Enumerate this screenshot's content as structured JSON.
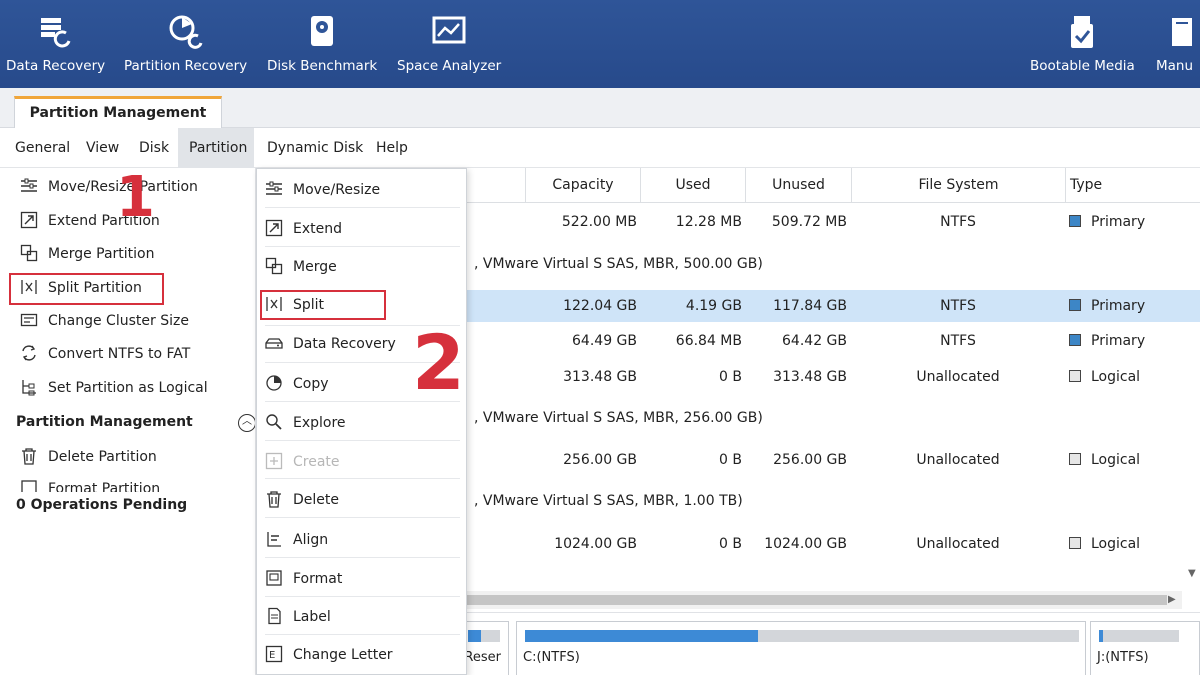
{
  "toolbar": {
    "items": [
      {
        "label": "Data Recovery",
        "icon": "data-recovery-icon"
      },
      {
        "label": "Partition Recovery",
        "icon": "partition-recovery-icon"
      },
      {
        "label": "Disk Benchmark",
        "icon": "disk-benchmark-icon"
      },
      {
        "label": "Space Analyzer",
        "icon": "space-analyzer-icon"
      },
      {
        "label": "Bootable Media",
        "icon": "bootable-media-icon"
      },
      {
        "label": "Manu",
        "icon": "manual-icon"
      }
    ]
  },
  "tab": {
    "label": "Partition Management"
  },
  "menubar": [
    "General",
    "View",
    "Disk",
    "Partition",
    "Dynamic Disk",
    "Help"
  ],
  "left_panel": {
    "items": [
      {
        "label": "Move/Resize Partition",
        "icon": "move-resize-icon"
      },
      {
        "label": "Extend Partition",
        "icon": "extend-icon"
      },
      {
        "label": "Merge Partition",
        "icon": "merge-icon"
      },
      {
        "label": "Split Partition",
        "icon": "split-icon"
      },
      {
        "label": "Change Cluster Size",
        "icon": "cluster-size-icon"
      },
      {
        "label": "Convert NTFS to FAT",
        "icon": "convert-icon"
      },
      {
        "label": "Set Partition as Logical",
        "icon": "set-logical-icon"
      }
    ],
    "section_title": "Partition Management",
    "section_items": [
      {
        "label": "Delete Partition",
        "icon": "delete-icon"
      },
      {
        "label": "Format Partition",
        "icon": "format-icon"
      }
    ],
    "pending": "0 Operations Pending"
  },
  "dropdown": {
    "items": [
      {
        "label": "Move/Resize",
        "icon": "move-resize-icon",
        "enabled": true
      },
      {
        "label": "Extend",
        "icon": "extend-icon",
        "enabled": true
      },
      {
        "label": "Merge",
        "icon": "merge-icon",
        "enabled": true
      },
      {
        "label": "Split",
        "icon": "split-icon",
        "enabled": true
      },
      {
        "label": "Data Recovery",
        "icon": "data-recovery-icon",
        "enabled": true
      },
      {
        "label": "Copy",
        "icon": "copy-icon",
        "enabled": true
      },
      {
        "label": "Explore",
        "icon": "explore-icon",
        "enabled": true
      },
      {
        "label": "Create",
        "icon": "create-icon",
        "enabled": false
      },
      {
        "label": "Delete",
        "icon": "delete-icon",
        "enabled": true
      },
      {
        "label": "Align",
        "icon": "align-icon",
        "enabled": true
      },
      {
        "label": "Format",
        "icon": "format-icon",
        "enabled": true
      },
      {
        "label": "Label",
        "icon": "label-icon",
        "enabled": true
      },
      {
        "label": "Change Letter",
        "icon": "change-letter-icon",
        "enabled": true
      }
    ]
  },
  "annotations": {
    "step1": "1",
    "step2": "2"
  },
  "table": {
    "columns": [
      "Capacity",
      "Used",
      "Unused",
      "File System",
      "Type"
    ],
    "rows": [
      {
        "kind": "partition",
        "capacity": "522.00 MB",
        "used": "12.28 MB",
        "unused": "509.72 MB",
        "fs": "NTFS",
        "type": "Primary",
        "selected": false
      },
      {
        "kind": "disk",
        "label": ", VMware Virtual S SAS, MBR, 500.00 GB)"
      },
      {
        "kind": "partition",
        "capacity": "122.04 GB",
        "used": "4.19 GB",
        "unused": "117.84 GB",
        "fs": "NTFS",
        "type": "Primary",
        "selected": true
      },
      {
        "kind": "partition",
        "capacity": "64.49 GB",
        "used": "66.84 MB",
        "unused": "64.42 GB",
        "fs": "NTFS",
        "type": "Primary",
        "selected": false
      },
      {
        "kind": "partition",
        "capacity": "313.48 GB",
        "used": "0 B",
        "unused": "313.48 GB",
        "fs": "Unallocated",
        "type": "Logical",
        "selected": false
      },
      {
        "kind": "disk",
        "label": ", VMware Virtual S SAS, MBR, 256.00 GB)"
      },
      {
        "kind": "partition",
        "capacity": "256.00 GB",
        "used": "0 B",
        "unused": "256.00 GB",
        "fs": "Unallocated",
        "type": "Logical",
        "selected": false
      },
      {
        "kind": "disk",
        "label": ", VMware Virtual S SAS, MBR, 1.00 TB)"
      },
      {
        "kind": "partition",
        "capacity": "1024.00 GB",
        "used": "0 B",
        "unused": "1024.00 GB",
        "fs": "Unallocated",
        "type": "Logical",
        "selected": false
      }
    ]
  },
  "diskmap": {
    "blocks": [
      {
        "label": "n Reser",
        "fill": 0.4
      },
      {
        "label": "C:(NTFS)",
        "fill": 0.42
      },
      {
        "label": "J:(NTFS)",
        "fill": 0.05
      }
    ]
  },
  "colors": {
    "toolbar_bg": "#2f5598",
    "highlight_red": "#d6303c",
    "selected_row": "#cfe4f8",
    "primary_square": "#3d86c6",
    "logical_square": "#e6e6e6",
    "bar_fill": "#3d8ad6"
  }
}
